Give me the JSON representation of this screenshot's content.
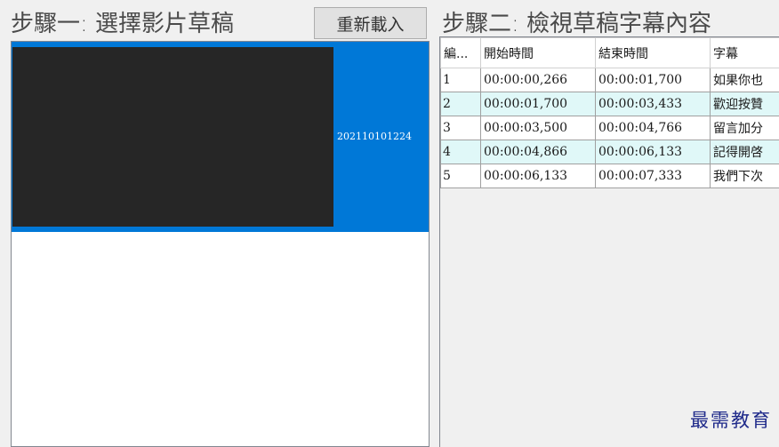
{
  "step1": {
    "title": "步驟一: 選擇影片草稿",
    "reload_label": "重新載入",
    "drafts": [
      {
        "name": "202110101224",
        "selected": true
      }
    ]
  },
  "step2": {
    "title": "步驟二: 檢視草稿字幕內容",
    "columns": [
      "編...",
      "開始時間",
      "結束時間",
      "字幕"
    ],
    "rows": [
      [
        "1",
        "00:00:00,266",
        "00:00:01,700",
        "如果你也"
      ],
      [
        "2",
        "00:00:01,700",
        "00:00:03,433",
        "歡迎按贊"
      ],
      [
        "3",
        "00:00:03,500",
        "00:00:04,766",
        "留言加分"
      ],
      [
        "4",
        "00:00:04,866",
        "00:00:06,133",
        "記得開啓"
      ],
      [
        "5",
        "00:00:06,133",
        "00:00:07,333",
        "我們下次"
      ]
    ]
  },
  "watermark": "最需教育",
  "colors": {
    "selection": "#0078d7",
    "alt_row": "#e0f8f8",
    "watermark": "#1f2a8a"
  }
}
